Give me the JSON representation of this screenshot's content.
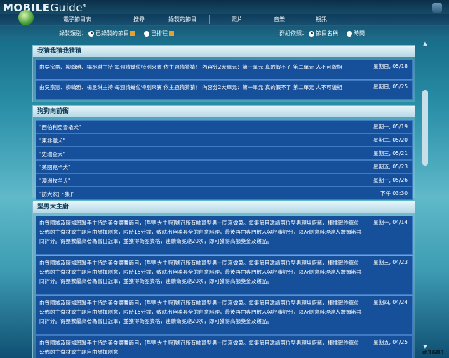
{
  "app": {
    "logo_main": "MOBILE",
    "logo_sub": "Guide",
    "logo_sup": "4"
  },
  "nav": [
    "電子節目表",
    "搜尋",
    "錄製的節目",
    "照片",
    "音樂",
    "視訊"
  ],
  "window_button": "...",
  "filter": {
    "category_label": "錄製類別：",
    "options": [
      "已錄製的節目",
      "已排程"
    ],
    "sort_label": "群組依照：",
    "sort_options": [
      "節目名稱",
      "時間"
    ]
  },
  "sections": [
    {
      "title": "我猜我猜我猜猜",
      "rows": [
        {
          "text": "由吳宗憲、柳翰雅、楊丞琳主持 每週請幾位特別來賓 依主題猜猜猜！ 內容分2大單元：第一單元 真的假不了 第二單元 人不可貌相",
          "date": "星期日, 05/18"
        },
        {
          "text": "由吳宗憲、柳翰雅、楊丞琳主持 每週請幾位特別來賓 依主題猜猜猜！ 內容分2大單元：第一單元 真的假不了 第二單元 人不可貌相",
          "date": "星期日, 05/25"
        }
      ]
    },
    {
      "title": "狗狗向前衝",
      "rows": [
        {
          "text": "\"西伯利亞雪橇犬\"",
          "date": "星期一, 05/19"
        },
        {
          "text": "\"東非獵犬\"",
          "date": "星期二, 05/20"
        },
        {
          "text": "\"史瑞查犬\"",
          "date": "星期三, 05/21"
        },
        {
          "text": "\"美國克卡犬\"",
          "date": "星期五, 05/23"
        },
        {
          "text": "\"澳洲牧羊犬\"",
          "date": "星期一, 05/26"
        },
        {
          "text": "\"訪犬家(下集)\"",
          "date": "下午 03:30"
        }
      ]
    },
    {
      "title": "型男大主廚",
      "rows": [
        {
          "text": "由曾國城及陳鴻恩聯手主持的美食競賽節目，[型男大主廚]號召所有帥哥型男一同來做菜。每集節目邀請兩位型男現場廚藝，棒擂戰作單位公佈的主食材或主題自由發揮創意，限時15分鐘，致就出色味具全的創意料理，最後再由專門數人與評審評分，以及創意料理達人詹姆斯共同評分。得票數最高者為當日冠軍，並獲得衛冕資格，連續衛冕達20次，即可獲得高額獎金及雞品。",
          "date": "星期一, 04/14"
        },
        {
          "text": "由曾國城及陳鴻恩聯手主持的美食競賽節目，[型男大主廚]號召所有帥哥型男一同來做菜。每集節目邀請兩位型男現場廚藝，棒擂戰作單位公佈的主食材或主題自由發揮創意，限時15分鐘，致就出色味具全的創意料理，最後再由專門數人與評審評分，以及創意料理達人詹姆斯共同評分。得票數最高者為當日冠軍，並獲得衛冕資格，連續衛冕達20次，即可獲得高額獎金及雞品。",
          "date": "星期三, 04/23"
        },
        {
          "text": "由曾國城及陳鴻恩聯手主持的美食競賽節目，[型男大主廚]號召所有帥哥型男一同來做菜。每集節目邀請兩位型男現場廚藝，棒擂戰作單位公佈的主食材或主題自由發揮創意，限時15分鐘，致就出色味具全的創意料理，最後再由專門數人與評審評分，以及創意料理達人詹姆斯共同評分。得票數最高者為當日冠軍，並獲得衛冕資格，連續衛冕達20次，即可獲得高額獎金及雞品。",
          "date": "星期四, 04/24"
        },
        {
          "text": "由曾國城及陳鴻恩聯手主持的美食競賽節目，[型男大主廚]號召所有帥哥型男一同來做菜。每集節目邀請兩位型男現場廚藝，棒擂戰作單位公佈的主食材或主題自由發揮創意",
          "date": "星期五, 04/25"
        }
      ]
    }
  ],
  "watermark": "#3681"
}
